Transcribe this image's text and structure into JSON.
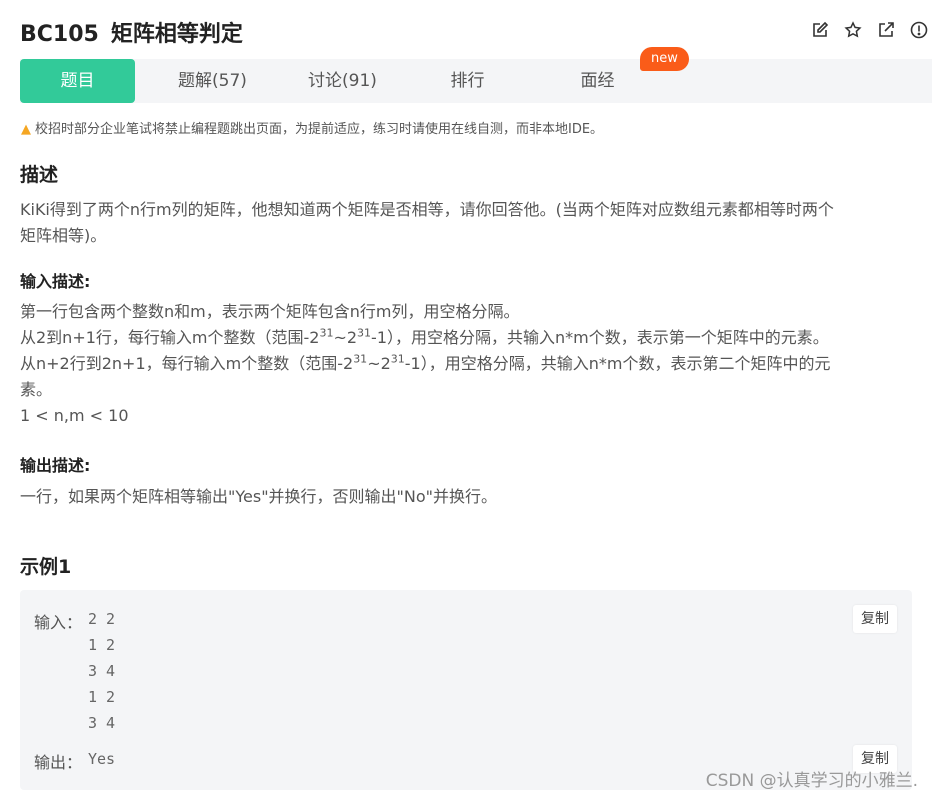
{
  "header": {
    "problem_id": "BC105",
    "problem_title": "矩阵相等判定",
    "icons": [
      "edit-icon",
      "star-icon",
      "external-link-icon",
      "info-icon"
    ]
  },
  "tabs": [
    {
      "label": "题目",
      "active": true
    },
    {
      "label": "题解(57)",
      "active": false
    },
    {
      "label": "讨论(91)",
      "active": false
    },
    {
      "label": "排行",
      "active": false
    },
    {
      "label": "面经",
      "active": false
    }
  ],
  "badge": "new",
  "notice": "校招时部分企业笔试将禁止编程题跳出页面，为提前适应，练习时请使用在线自测，而非本地IDE。",
  "description": {
    "heading": "描述",
    "line1": "KiKi得到了两个n行m列的矩阵，他想知道两个矩阵是否相等，请你回答他。(当两个矩阵对应数组元素都相等时两个",
    "line2": "矩阵相等)。"
  },
  "input_desc": {
    "heading": "输入描述:",
    "line1": "第一行包含两个整数n和m，表示两个矩阵包含n行m列，用空格分隔。",
    "line2_a": "从2到n+1行，每行输入m个整数（范围-2",
    "line2_b": "~2",
    "line2_c": "-1），用空格分隔，共输入n*m个数，表示第一个矩阵中的元素。",
    "line3_a": "从n+2行到2n+1，每行输入m个整数（范围-2",
    "line3_b": "~2",
    "line3_c": "-1），用空格分隔，共输入n*m个数，表示第二个矩阵中的元",
    "line4": "素。",
    "exp": "31",
    "line5": "1 < n,m < 10"
  },
  "output_desc": {
    "heading": "输出描述:",
    "line1": "一行，如果两个矩阵相等输出\"Yes\"并换行，否则输出\"No\"并换行。"
  },
  "example": {
    "heading": "示例1",
    "input_label": "输入：",
    "input_lines": [
      "2 2",
      "1 2",
      "3 4",
      "1 2",
      "3 4"
    ],
    "output_label": "输出：",
    "output_value": "Yes",
    "copy_label": "复制"
  },
  "watermark": "CSDN @认真学习的小雅兰."
}
